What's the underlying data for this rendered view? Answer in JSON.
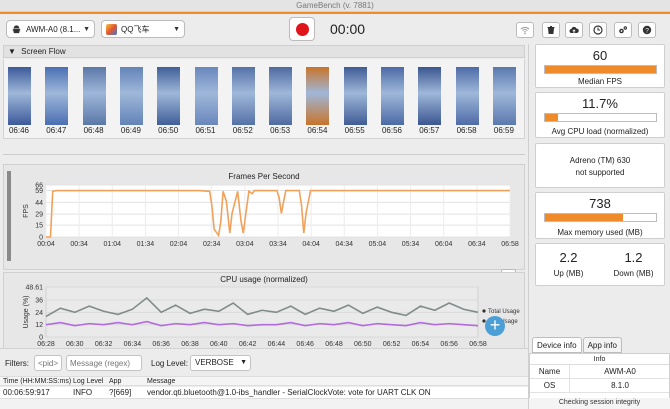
{
  "window": {
    "title": "GameBench (v. 7881)"
  },
  "toolbar": {
    "device_label": "AWM-A0 (8.1...",
    "app_label": "QQ飞车",
    "timer": "00:00",
    "icons": [
      "wifi-icon",
      "trash-icon",
      "cloud-upload-icon",
      "clock-icon",
      "settings-icon",
      "help-icon"
    ]
  },
  "screen_flow": {
    "title": "Screen Flow",
    "frames": [
      {
        "time": "06:46",
        "tone": "#3c5a9a"
      },
      {
        "time": "06:47",
        "tone": "#4a6fb3"
      },
      {
        "time": "06:48",
        "tone": "#5a78a8"
      },
      {
        "time": "06:49",
        "tone": "#6384b8"
      },
      {
        "time": "06:50",
        "tone": "#405f98"
      },
      {
        "time": "06:51",
        "tone": "#6a87bd"
      },
      {
        "time": "06:52",
        "tone": "#5572a8"
      },
      {
        "time": "06:53",
        "tone": "#4f6aa0"
      },
      {
        "time": "06:54",
        "tone": "#c8742a"
      },
      {
        "time": "06:55",
        "tone": "#3f5c95"
      },
      {
        "time": "06:56",
        "tone": "#4b6aa6"
      },
      {
        "time": "06:57",
        "tone": "#3a5690"
      },
      {
        "time": "06:58",
        "tone": "#4e6ba8"
      },
      {
        "time": "06:59",
        "tone": "#5b79ae"
      }
    ]
  },
  "chart_data": [
    {
      "type": "line",
      "title": "Frames Per Second",
      "ylabel": "FPS",
      "ylim": [
        0,
        66
      ],
      "yticks": [
        0,
        15,
        29,
        44,
        59,
        66
      ],
      "xticks": [
        "00:04",
        "00:34",
        "01:04",
        "01:34",
        "02:04",
        "02:34",
        "03:04",
        "03:34",
        "04:04",
        "04:34",
        "05:04",
        "05:34",
        "06:04",
        "06:34",
        "06:58"
      ],
      "x_range_seconds": [
        4,
        418
      ],
      "color": "#f0a15a",
      "series": [
        {
          "x": [
            4,
            8,
            10,
            14,
            30,
            60,
            90,
            120,
            140,
            150,
            152,
            154,
            158,
            160,
            162,
            165,
            168,
            170,
            175,
            178,
            180,
            185,
            188,
            190,
            200,
            210,
            212,
            214,
            216,
            218,
            222,
            230,
            232,
            234,
            236,
            240,
            250,
            280,
            320,
            360,
            400,
            418
          ],
          "y": [
            0,
            0,
            58,
            59,
            59,
            59,
            59,
            59,
            59,
            58,
            40,
            10,
            2,
            20,
            58,
            45,
            5,
            30,
            58,
            20,
            5,
            58,
            55,
            59,
            59,
            59,
            50,
            30,
            45,
            59,
            59,
            59,
            40,
            5,
            30,
            59,
            59,
            59,
            59,
            59,
            59,
            59
          ]
        }
      ]
    },
    {
      "type": "line",
      "title": "CPU usage (normalized)",
      "ylabel": "Usage (%)",
      "ylim": [
        0,
        48.61
      ],
      "yticks": [
        0,
        12,
        24,
        36,
        48.61
      ],
      "ytick_labels": [
        "0",
        "12",
        "24",
        "36",
        "48.61"
      ],
      "xticks": [
        "06:28",
        "06:30",
        "06:32",
        "06:34",
        "06:36",
        "06:38",
        "06:40",
        "06:42",
        "06:44",
        "06:46",
        "06:48",
        "06:50",
        "06:52",
        "06:54",
        "06:56",
        "06:58"
      ],
      "x_range_seconds": [
        0,
        30
      ],
      "legend": "right",
      "series": [
        {
          "name": "Total Usage",
          "color": "#7f8c8a",
          "x": [
            0,
            1,
            2,
            3,
            4,
            5,
            6,
            7,
            8,
            9,
            10,
            11,
            12,
            13,
            14,
            15,
            16,
            17,
            18,
            19,
            20,
            21,
            22,
            23,
            24,
            25,
            26,
            27,
            28,
            29,
            30
          ],
          "y": [
            20,
            28,
            24,
            30,
            25,
            22,
            27,
            38,
            24,
            31,
            23,
            27,
            25,
            33,
            22,
            26,
            24,
            30,
            22,
            28,
            25,
            31,
            23,
            29,
            24,
            21,
            30,
            26,
            33,
            27,
            24
          ]
        },
        {
          "name": "App Usage",
          "color": "#b36be0",
          "x": [
            0,
            1,
            2,
            3,
            4,
            5,
            6,
            7,
            8,
            9,
            10,
            11,
            12,
            13,
            14,
            15,
            16,
            17,
            18,
            19,
            20,
            21,
            22,
            23,
            24,
            25,
            26,
            27,
            28,
            29,
            30
          ],
          "y": [
            12,
            14,
            11,
            13,
            12,
            14,
            12,
            15,
            11,
            13,
            12,
            14,
            12,
            13,
            11,
            12,
            12,
            14,
            11,
            13,
            12,
            14,
            11,
            13,
            12,
            11,
            14,
            12,
            13,
            12,
            11
          ]
        }
      ]
    }
  ],
  "filters": {
    "label": "Filters:",
    "pid_placeholder": "<pid>",
    "regex_placeholder": "Message (regex)",
    "level_label": "Log Level:",
    "level_value": "VERBOSE"
  },
  "log": {
    "headers": [
      "Time (HH:MM:SS:ms)",
      "Log Level",
      "App",
      "Message"
    ],
    "rows": [
      [
        "00:06:59:917",
        "INFO",
        "?[669]",
        "vendor.qti.bluetooth@1.0-ibs_handler - SerialClockVote: vote for UART CLK ON"
      ]
    ]
  },
  "stats": {
    "fps": {
      "value": "60",
      "label": "Median FPS",
      "fill": 1.0
    },
    "cpu": {
      "value": "11.7%",
      "label": "Avg CPU load (normalized)",
      "fill": 0.117
    },
    "gpu": {
      "line1": "Adreno (TM) 630",
      "line2": "not supported"
    },
    "memory": {
      "value": "738",
      "label": "Max memory used (MB)",
      "fill": 0.7
    },
    "network": {
      "up_value": "2.2",
      "up_label": "Up (MB)",
      "down_value": "1.2",
      "down_label": "Down (MB)"
    }
  },
  "device_tabs": [
    {
      "label": "Device info",
      "active": true
    },
    {
      "label": "App info",
      "active": false
    }
  ],
  "device_info": {
    "header": "Info",
    "rows": [
      {
        "key": "Name",
        "value": "AWM-A0"
      },
      {
        "key": "OS",
        "value": "8.1.0"
      }
    ]
  },
  "integrity": "Checking session integrity"
}
